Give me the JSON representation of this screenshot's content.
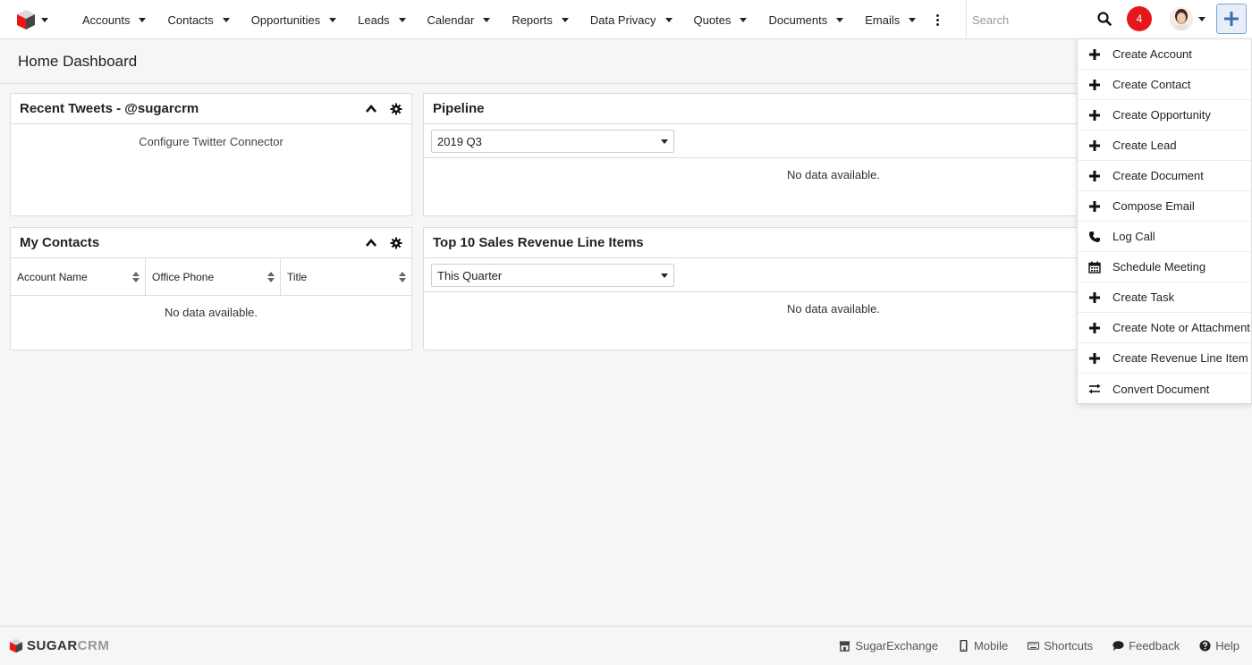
{
  "nav": {
    "items": [
      {
        "label": "Accounts"
      },
      {
        "label": "Contacts"
      },
      {
        "label": "Opportunities"
      },
      {
        "label": "Leads"
      },
      {
        "label": "Calendar"
      },
      {
        "label": "Reports"
      },
      {
        "label": "Data Privacy"
      },
      {
        "label": "Quotes"
      },
      {
        "label": "Documents"
      },
      {
        "label": "Emails"
      }
    ],
    "search_placeholder": "Search",
    "notification_count": "4"
  },
  "header": {
    "title": "Home Dashboard"
  },
  "dashlets": {
    "tweets": {
      "title": "Recent Tweets - @sugarcrm",
      "body": "Configure Twitter Connector"
    },
    "pipeline": {
      "title": "Pipeline",
      "filter": "2019 Q3",
      "empty": "No data available."
    },
    "contacts": {
      "title": "My Contacts",
      "columns": [
        "Account Name",
        "Office Phone",
        "Title"
      ],
      "empty": "No data available."
    },
    "revenue": {
      "title": "Top 10 Sales Revenue Line Items",
      "filter": "This Quarter",
      "empty": "No data available."
    }
  },
  "quick_create_menu": {
    "items": [
      {
        "label": "Create Account",
        "icon": "plus-icon"
      },
      {
        "label": "Create Contact",
        "icon": "plus-icon"
      },
      {
        "label": "Create Opportunity",
        "icon": "plus-icon"
      },
      {
        "label": "Create Lead",
        "icon": "plus-icon"
      },
      {
        "label": "Create Document",
        "icon": "plus-icon"
      },
      {
        "label": "Compose Email",
        "icon": "plus-icon"
      },
      {
        "label": "Log Call",
        "icon": "phone-icon"
      },
      {
        "label": "Schedule Meeting",
        "icon": "calendar-icon"
      },
      {
        "label": "Create Task",
        "icon": "plus-icon"
      },
      {
        "label": "Create Note or Attachment",
        "icon": "plus-icon"
      },
      {
        "label": "Create Revenue Line Item",
        "icon": "plus-icon"
      },
      {
        "label": "Convert Document",
        "icon": "exchange-icon"
      }
    ]
  },
  "footer": {
    "brand_sugar": "SUGAR",
    "brand_crm": "CRM",
    "links": [
      {
        "label": "SugarExchange",
        "icon": "store-icon"
      },
      {
        "label": "Mobile",
        "icon": "mobile-icon"
      },
      {
        "label": "Shortcuts",
        "icon": "keyboard-icon"
      },
      {
        "label": "Feedback",
        "icon": "comment-icon"
      },
      {
        "label": "Help",
        "icon": "help-icon"
      }
    ]
  },
  "colors": {
    "badge": "#e61718",
    "brand_red": "#e61718",
    "quick_create_border": "#7aa5d8"
  }
}
